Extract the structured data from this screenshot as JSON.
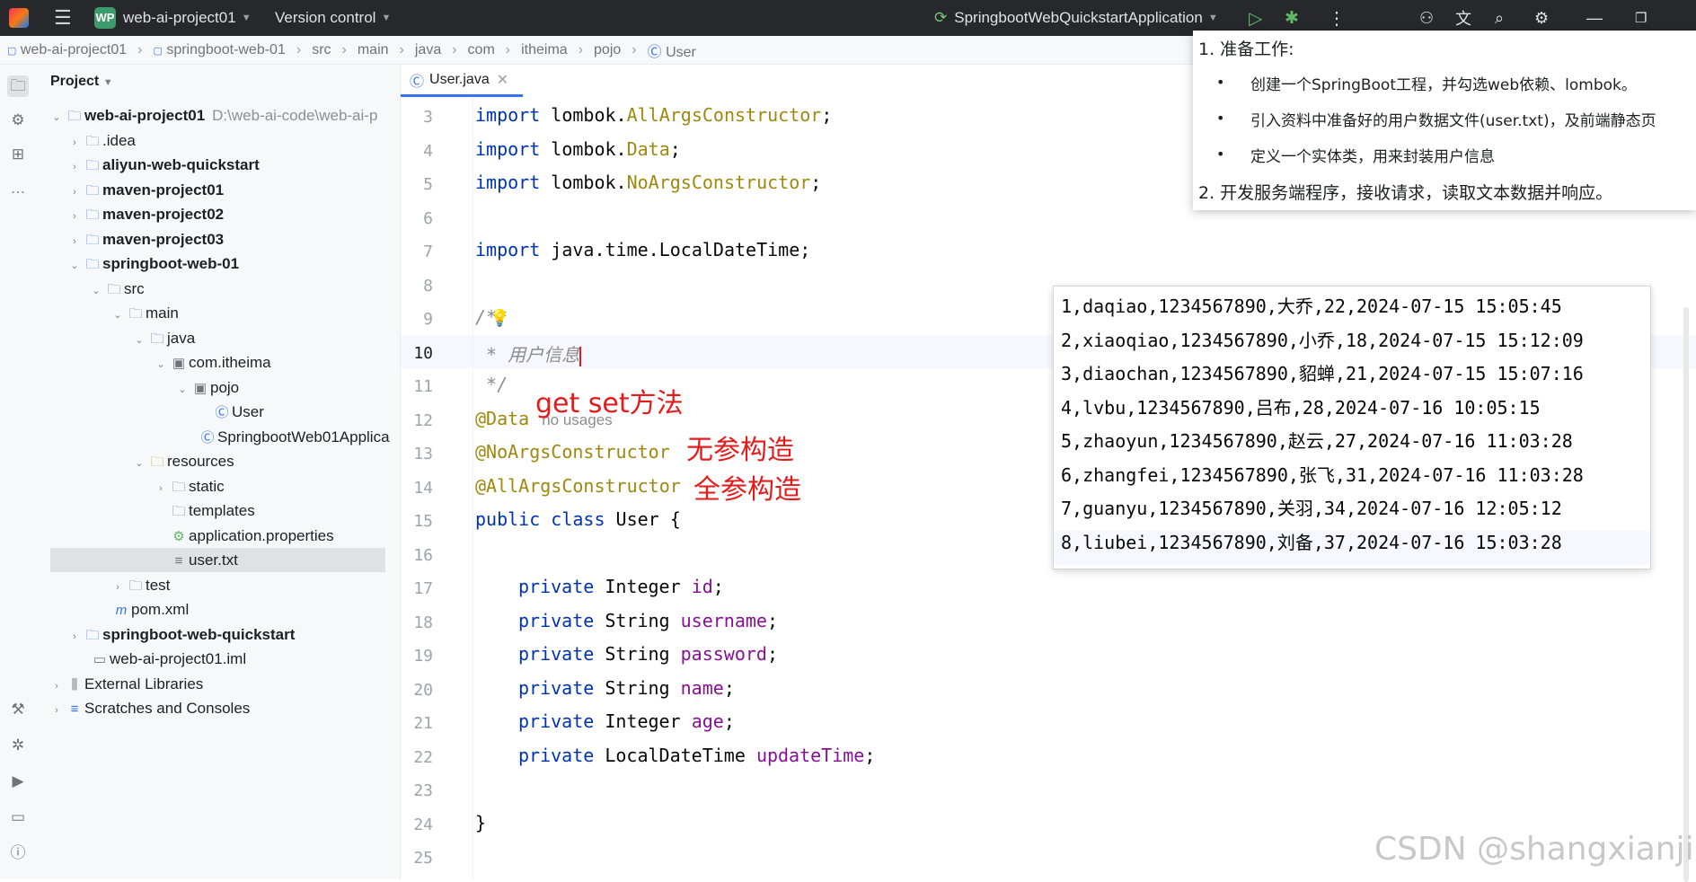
{
  "titlebar": {
    "project_badge": "WP",
    "project_name": "web-ai-project01",
    "vcs": "Version control",
    "run_config": "SpringbootWebQuickstartApplication"
  },
  "breadcrumb": [
    "web-ai-project01",
    "springboot-web-01",
    "src",
    "main",
    "java",
    "com",
    "itheima",
    "pojo",
    "User"
  ],
  "project_panel": {
    "title": "Project",
    "tree": [
      {
        "label": "web-ai-project01",
        "extra": "D:\\web-ai-code\\web-ai-p",
        "bold": true
      },
      {
        "label": ".idea"
      },
      {
        "label": "aliyun-web-quickstart",
        "bold": true
      },
      {
        "label": "maven-project01",
        "bold": true
      },
      {
        "label": "maven-project02",
        "bold": true
      },
      {
        "label": "maven-project03",
        "bold": true
      },
      {
        "label": "springboot-web-01",
        "bold": true
      },
      {
        "label": "src"
      },
      {
        "label": "main"
      },
      {
        "label": "java"
      },
      {
        "label": "com.itheima"
      },
      {
        "label": "pojo"
      },
      {
        "label": "User"
      },
      {
        "label": "SpringbootWeb01Applica"
      },
      {
        "label": "resources"
      },
      {
        "label": "static"
      },
      {
        "label": "templates"
      },
      {
        "label": "application.properties"
      },
      {
        "label": "user.txt"
      },
      {
        "label": "test"
      },
      {
        "label": "pom.xml"
      },
      {
        "label": "springboot-web-quickstart",
        "bold": true
      },
      {
        "label": "web-ai-project01.iml"
      },
      {
        "label": "External Libraries"
      },
      {
        "label": "Scratches and Consoles"
      }
    ]
  },
  "editor": {
    "tab": "User.java",
    "line_numbers": [
      "3",
      "4",
      "5",
      "6",
      "7",
      "8",
      "9",
      "10",
      "11",
      "12",
      "13",
      "14",
      "15",
      "16",
      "17",
      "18",
      "19",
      "20",
      "21",
      "22",
      "23",
      "24",
      "25"
    ],
    "code": {
      "l3": [
        "import",
        " lombok.",
        "AllArgsConstructor",
        ";"
      ],
      "l4": [
        "import",
        " lombok.",
        "Data",
        ";"
      ],
      "l5": [
        "import",
        " lombok.",
        "NoArgsConstructor",
        ";"
      ],
      "l7": [
        "import",
        " java.time.LocalDateTime;"
      ],
      "l9": "/**",
      "l10": " * 用户信息",
      "l11": " */",
      "l12": "@Data",
      "l12_hint": "no usages",
      "l13": "@NoArgsConstructor",
      "l14": "@AllArgsConstructor",
      "l15": [
        "public",
        "class",
        " User {"
      ],
      "fields": [
        {
          "type": "Integer",
          "name": "id"
        },
        {
          "type": "String",
          "name": "username"
        },
        {
          "type": "String",
          "name": "password"
        },
        {
          "type": "String",
          "name": "name"
        },
        {
          "type": "Integer",
          "name": "age"
        },
        {
          "type": "LocalDateTime",
          "name": "updateTime"
        }
      ],
      "private_kw": "private",
      "l24": "}"
    }
  },
  "annotations": {
    "getset": "get set方法",
    "noargs": "无参构造",
    "allargs": "全参构造"
  },
  "note": {
    "item1": "1. 准备工作:",
    "bullets": [
      "创建一个SpringBoot工程，并勾选web依赖、lombok。",
      "引入资料中准备好的用户数据文件(user.txt)，及前端静态页",
      "定义一个实体类，用来封装用户信息"
    ],
    "item2": "2. 开发服务端程序，接收请求，读取文本数据并响应。"
  },
  "user_txt": [
    "1,daqiao,1234567890,大乔,22,2024-07-15 15:05:45",
    "2,xiaoqiao,1234567890,小乔,18,2024-07-15 15:12:09",
    "3,diaochan,1234567890,貂蝉,21,2024-07-15 15:07:16",
    "4,lvbu,1234567890,吕布,28,2024-07-16 10:05:15",
    "5,zhaoyun,1234567890,赵云,27,2024-07-16 11:03:28",
    "6,zhangfei,1234567890,张飞,31,2024-07-16 11:03:28",
    "7,guanyu,1234567890,关羽,34,2024-07-16 12:05:12",
    "8,liubei,1234567890,刘备,37,2024-07-16 15:03:28"
  ],
  "watermark": "CSDN @shangxianjiao"
}
